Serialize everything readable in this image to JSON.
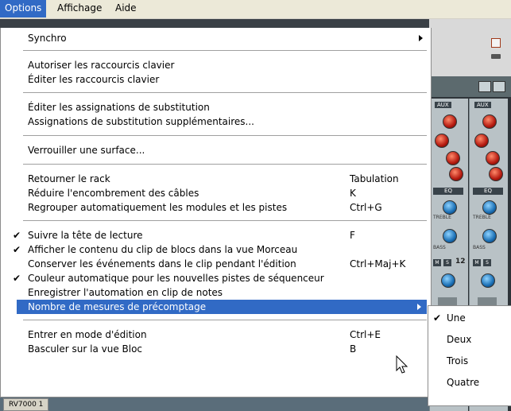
{
  "menubar": {
    "items": [
      {
        "label": "Options"
      },
      {
        "label": "Affichage"
      },
      {
        "label": "Aide"
      }
    ]
  },
  "menu": {
    "items": [
      {
        "label": "Synchro",
        "submenu": true
      },
      {
        "label": "Autoriser les raccourcis clavier"
      },
      {
        "label": "Éditer les raccourcis clavier"
      },
      {
        "label": "Éditer les assignations de substitution"
      },
      {
        "label": "Assignations de substitution supplémentaires..."
      },
      {
        "label": "Verrouiller une surface..."
      },
      {
        "label": "Retourner le rack",
        "shortcut": "Tabulation"
      },
      {
        "label": "Réduire l'encombrement des câbles",
        "shortcut": "K"
      },
      {
        "label": "Regrouper automatiquement les modules et les pistes",
        "shortcut": "Ctrl+G"
      },
      {
        "label": "Suivre la tête de lecture",
        "shortcut": "F",
        "checked": true
      },
      {
        "label": "Afficher le contenu du clip de blocs dans la vue Morceau",
        "checked": true
      },
      {
        "label": "Conserver les événements dans le clip pendant l'édition",
        "shortcut": "Ctrl+Maj+K"
      },
      {
        "label": "Couleur automatique pour les nouvelles pistes de séquenceur",
        "checked": true
      },
      {
        "label": "Enregistrer l'automation en clip de notes"
      },
      {
        "label": "Nombre de mesures de précomptage",
        "submenu": true,
        "highlighted": true
      },
      {
        "label": "Entrer en mode d'édition",
        "shortcut": "Ctrl+E"
      },
      {
        "label": "Basculer sur la vue Bloc",
        "shortcut": "B"
      }
    ],
    "check_glyph": "✔"
  },
  "submenu": {
    "items": [
      {
        "label": "Une",
        "checked": true
      },
      {
        "label": "Deux"
      },
      {
        "label": "Trois"
      },
      {
        "label": "Quatre"
      }
    ]
  },
  "rack": {
    "aux_label": "AUX",
    "eq_label": "EQ",
    "treble_label": "TREBLE",
    "bass_label": "BASS",
    "channel_number": "12",
    "mute_label": "M",
    "solo_label": "S"
  },
  "taskbar": {
    "label": "RV7000 1"
  },
  "colors": {
    "highlight": "#316ac5",
    "menubar": "#ece9d8"
  }
}
